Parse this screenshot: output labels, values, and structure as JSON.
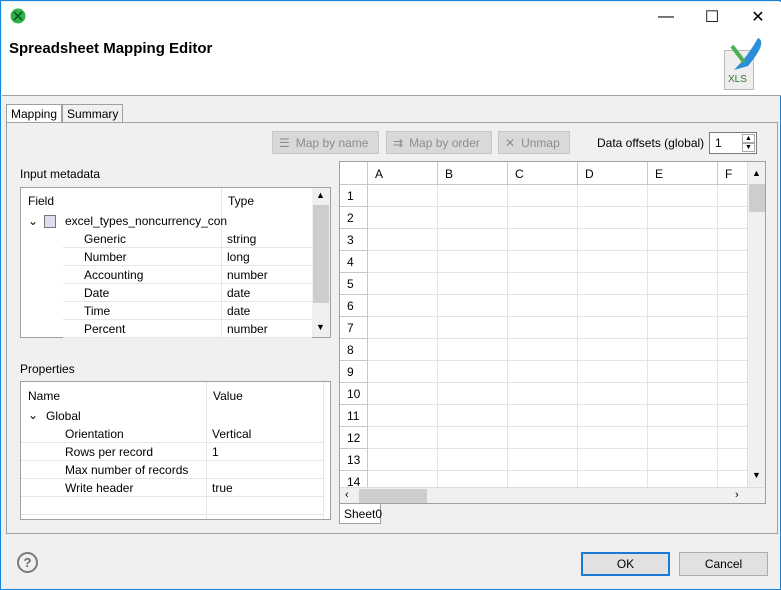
{
  "window": {
    "title": "Spreadsheet Mapping Editor",
    "controls": {
      "minimize": "—",
      "maximize": "☐",
      "close": "✕"
    },
    "logo_text": "XLS"
  },
  "tabs": [
    {
      "label": "Mapping",
      "active": true
    },
    {
      "label": "Summary",
      "active": false
    }
  ],
  "toolbar": {
    "map_by_name": "Map by name",
    "map_by_order": "Map by order",
    "unmap": "Unmap",
    "data_offsets_label": "Data offsets (global)",
    "data_offsets_value": "1"
  },
  "input_metadata": {
    "label": "Input metadata",
    "columns": [
      "Field",
      "Type"
    ],
    "root": "excel_types_noncurrency_con",
    "rows": [
      {
        "field": "Generic",
        "type": "string"
      },
      {
        "field": "Number",
        "type": "long"
      },
      {
        "field": "Accounting",
        "type": "number"
      },
      {
        "field": "Date",
        "type": "date"
      },
      {
        "field": "Time",
        "type": "date"
      },
      {
        "field": "Percent",
        "type": "number"
      }
    ]
  },
  "properties": {
    "label": "Properties",
    "columns": [
      "Name",
      "Value"
    ],
    "group": "Global",
    "rows": [
      {
        "name": "Orientation",
        "value": "Vertical"
      },
      {
        "name": "Rows per record",
        "value": "1"
      },
      {
        "name": "Max number of records",
        "value": ""
      },
      {
        "name": "Write header",
        "value": "true"
      }
    ]
  },
  "sheet": {
    "columns": [
      "A",
      "B",
      "C",
      "D",
      "E",
      "F"
    ],
    "rows": [
      "1",
      "2",
      "3",
      "4",
      "5",
      "6",
      "7",
      "8",
      "9",
      "10",
      "11",
      "12",
      "13",
      "14"
    ],
    "sheet_tab": "Sheet0"
  },
  "footer": {
    "help": "?",
    "ok": "OK",
    "cancel": "Cancel"
  }
}
